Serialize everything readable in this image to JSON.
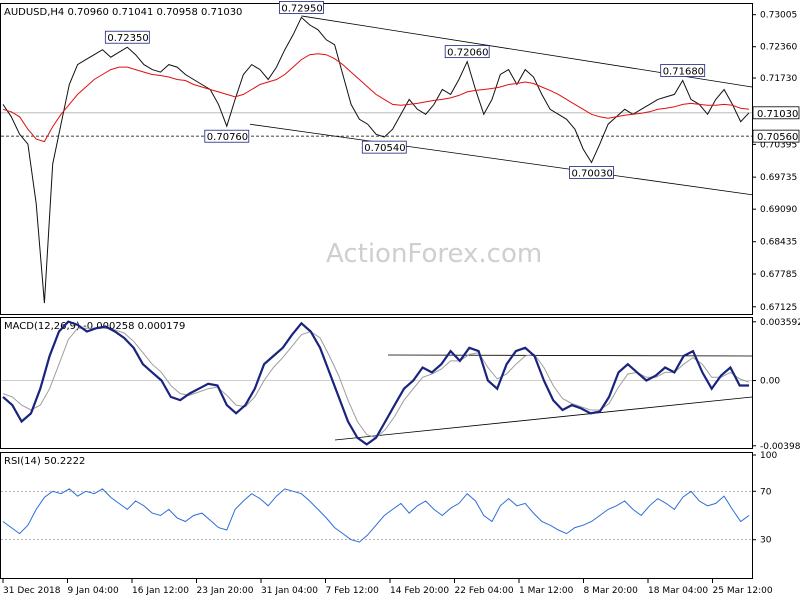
{
  "header": {
    "title": "AUDUSD,H4  0.70960 0.71041 0.70958 0.71030"
  },
  "watermark": "ActionForex.com",
  "colors": {
    "price": "#111111",
    "ma": "#e01010",
    "macd": "#1a237e",
    "signal": "#9e9e9e",
    "rsi": "#2d6fd6",
    "frame": "#000000"
  },
  "chart_data": [
    {
      "type": "line",
      "title": "AUDUSD,H4  0.70960 0.71041 0.70958 0.71030",
      "ylim": [
        0.67,
        0.732
      ],
      "yticks": [
        "0.73005",
        "0.72360",
        "0.71730",
        "0.71030",
        "0.70560",
        "0.70395",
        "0.69735",
        "0.69090",
        "0.68435",
        "0.67785",
        "0.67125"
      ],
      "xticks": [
        "31 Dec 2018",
        "9 Jan 04:00",
        "16 Jan 12:00",
        "23 Jan 20:00",
        "31 Jan 04:00",
        "7 Feb 12:00",
        "14 Feb 20:00",
        "22 Feb 04:00",
        "1 Mar 12:00",
        "8 Mar 20:00",
        "18 Mar 04:00",
        "25 Mar 12:00"
      ],
      "series": [
        {
          "values": [
            0.712,
            0.7095,
            0.706,
            0.704,
            0.692,
            0.672,
            0.7,
            0.708,
            0.716,
            0.72,
            0.721,
            0.722,
            0.723,
            0.7215,
            0.7225,
            0.7235,
            0.722,
            0.72,
            0.719,
            0.7185,
            0.72,
            0.7195,
            0.718,
            0.717,
            0.716,
            0.715,
            0.712,
            0.7076,
            0.713,
            0.718,
            0.72,
            0.719,
            0.717,
            0.7195,
            0.723,
            0.726,
            0.7295,
            0.728,
            0.727,
            0.725,
            0.724,
            0.718,
            0.712,
            0.709,
            0.708,
            0.706,
            0.7054,
            0.707,
            0.71,
            0.713,
            0.711,
            0.71,
            0.712,
            0.715,
            0.714,
            0.717,
            0.7206,
            0.715,
            0.71,
            0.713,
            0.718,
            0.719,
            0.716,
            0.719,
            0.7175,
            0.714,
            0.711,
            0.71,
            0.709,
            0.707,
            0.703,
            0.7003,
            0.704,
            0.708,
            0.7095,
            0.711,
            0.71,
            0.711,
            0.712,
            0.713,
            0.7135,
            0.714,
            0.7168,
            0.713,
            0.712,
            0.71,
            0.713,
            0.715,
            0.712,
            0.7085,
            0.7103
          ]
        },
        {
          "values": [
            0.711,
            0.7105,
            0.7095,
            0.707,
            0.705,
            0.7045,
            0.7075,
            0.71,
            0.712,
            0.714,
            0.7155,
            0.717,
            0.718,
            0.719,
            0.7195,
            0.7195,
            0.719,
            0.7185,
            0.718,
            0.7178,
            0.7175,
            0.717,
            0.7168,
            0.716,
            0.7155,
            0.715,
            0.7145,
            0.714,
            0.7135,
            0.714,
            0.715,
            0.716,
            0.7165,
            0.717,
            0.718,
            0.7195,
            0.721,
            0.722,
            0.7222,
            0.722,
            0.7212,
            0.72,
            0.7185,
            0.717,
            0.7155,
            0.714,
            0.713,
            0.712,
            0.7118,
            0.712,
            0.7122,
            0.7125,
            0.7128,
            0.713,
            0.7133,
            0.7138,
            0.7145,
            0.7148,
            0.715,
            0.7152,
            0.7155,
            0.716,
            0.7162,
            0.7165,
            0.7162,
            0.7155,
            0.7148,
            0.714,
            0.713,
            0.712,
            0.711,
            0.71,
            0.7095,
            0.7092,
            0.7095,
            0.7098,
            0.71,
            0.7102,
            0.7105,
            0.711,
            0.7112,
            0.7115,
            0.712,
            0.7122,
            0.712,
            0.7118,
            0.7118,
            0.712,
            0.7118,
            0.7112,
            0.711
          ]
        }
      ],
      "level_labels": [
        {
          "text": "0.72350",
          "value": 0.7235
        },
        {
          "text": "0.72950",
          "value": 0.7295
        },
        {
          "text": "0.72060",
          "value": 0.7206
        },
        {
          "text": "0.71680",
          "value": 0.7168
        },
        {
          "text": "0.70760",
          "value": 0.7076
        },
        {
          "text": "0.70540",
          "value": 0.7054
        },
        {
          "text": "0.70030",
          "value": 0.7003
        }
      ],
      "current_price": {
        "text": "0.71030",
        "value": 0.7103
      },
      "support_line": {
        "text": "0.70560",
        "value": 0.7056
      }
    },
    {
      "type": "line",
      "title": "MACD(12,26,9) -0.000258 0.000179",
      "ylim": [
        -0.004,
        0.0037
      ],
      "yticks": [
        "0.003592",
        "0.00",
        "-0.003986"
      ],
      "series": [
        {
          "values": [
            -0.001,
            -0.0015,
            -0.0025,
            -0.002,
            -0.0005,
            0.0015,
            0.003,
            0.0036,
            0.0034,
            0.003,
            0.0032,
            0.0033,
            0.003,
            0.0026,
            0.002,
            0.001,
            0.0005,
            0.0,
            -0.001,
            -0.0012,
            -0.0008,
            -0.0005,
            -0.0002,
            -0.0003,
            -0.0015,
            -0.002,
            -0.0015,
            -0.0005,
            0.001,
            0.0015,
            0.002,
            0.0028,
            0.0035,
            0.003,
            0.002,
            0.0005,
            -0.001,
            -0.0025,
            -0.0035,
            -0.0039,
            -0.0035,
            -0.0025,
            -0.0015,
            -0.0005,
            0.0,
            0.0008,
            0.0005,
            0.001,
            0.0018,
            0.0012,
            0.002,
            0.0018,
            0.0,
            -0.0005,
            0.001,
            0.0018,
            0.002,
            0.0015,
            0.0,
            -0.0012,
            -0.0018,
            -0.0015,
            -0.0017,
            -0.002,
            -0.0019,
            -0.001,
            0.0005,
            0.001,
            0.0005,
            0.0,
            0.0003,
            0.0008,
            0.0005,
            0.0015,
            0.0018,
            0.0005,
            -0.0005,
            0.0003,
            0.0008,
            -0.0003,
            -0.0003
          ]
        },
        {
          "values": [
            -0.0008,
            -0.001,
            -0.0015,
            -0.0018,
            -0.0015,
            -0.0005,
            0.001,
            0.0025,
            0.0032,
            0.0032,
            0.0032,
            0.0032,
            0.0031,
            0.0029,
            0.0024,
            0.0017,
            0.001,
            0.0005,
            -0.0003,
            -0.0008,
            -0.0009,
            -0.0007,
            -0.0005,
            -0.0004,
            -0.0009,
            -0.0015,
            -0.0016,
            -0.001,
            0.0,
            0.0008,
            0.0014,
            0.0021,
            0.0028,
            0.003,
            0.0026,
            0.0015,
            0.0003,
            -0.0012,
            -0.0025,
            -0.0033,
            -0.0035,
            -0.003,
            -0.0022,
            -0.0012,
            -0.0005,
            0.0002,
            0.0004,
            0.0007,
            0.0012,
            0.0012,
            0.0016,
            0.0017,
            0.0008,
            0.0001,
            0.0004,
            0.001,
            0.0015,
            0.0016,
            0.0008,
            -0.0003,
            -0.0011,
            -0.0014,
            -0.0016,
            -0.0018,
            -0.0018,
            -0.0014,
            -0.0004,
            0.0004,
            0.0005,
            0.0002,
            0.0002,
            0.0005,
            0.0005,
            0.001,
            0.0014,
            0.001,
            0.0002,
            0.0002,
            0.0005,
            0.0001,
            -0.0001
          ]
        }
      ]
    },
    {
      "type": "line",
      "title": "RSI(14) 50.2222",
      "ylim": [
        0,
        100
      ],
      "yticks": [
        "100",
        "70",
        "30",
        "0"
      ],
      "levels": [
        70,
        30
      ],
      "series": [
        {
          "values": [
            45,
            40,
            35,
            42,
            55,
            65,
            70,
            68,
            72,
            66,
            70,
            68,
            72,
            65,
            60,
            55,
            62,
            58,
            52,
            50,
            55,
            48,
            45,
            50,
            52,
            46,
            40,
            38,
            55,
            62,
            68,
            64,
            58,
            66,
            72,
            70,
            68,
            62,
            55,
            48,
            40,
            35,
            30,
            28,
            34,
            42,
            50,
            55,
            60,
            52,
            58,
            62,
            55,
            50,
            56,
            60,
            68,
            62,
            50,
            45,
            58,
            64,
            58,
            60,
            52,
            45,
            42,
            38,
            35,
            40,
            42,
            45,
            50,
            55,
            58,
            62,
            55,
            50,
            58,
            64,
            60,
            55,
            65,
            70,
            62,
            58,
            60,
            66,
            55,
            45,
            50
          ]
        }
      ]
    }
  ]
}
